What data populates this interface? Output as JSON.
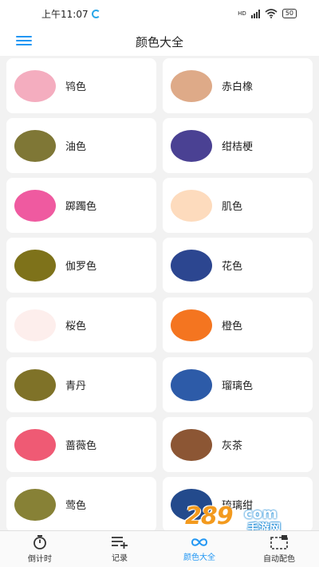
{
  "status_bar": {
    "time": "上午11:07",
    "network": "HD",
    "battery": "50"
  },
  "header": {
    "title": "颜色大全",
    "menu_icon": "hamburger-menu-icon"
  },
  "colors": [
    {
      "name": "鸨色",
      "hex": "#f4adbf"
    },
    {
      "name": "赤白橡",
      "hex": "#deaa88"
    },
    {
      "name": "油色",
      "hex": "#7f7736"
    },
    {
      "name": "绀桔梗",
      "hex": "#4a4193"
    },
    {
      "name": "踯躅色",
      "hex": "#ef5aa0"
    },
    {
      "name": "肌色",
      "hex": "#fddbbd"
    },
    {
      "name": "伽罗色",
      "hex": "#7e721a"
    },
    {
      "name": "花色",
      "hex": "#2c4690"
    },
    {
      "name": "桜色",
      "hex": "#fdeeec"
    },
    {
      "name": "橙色",
      "hex": "#f47520"
    },
    {
      "name": "青丹",
      "hex": "#7f7228"
    },
    {
      "name": "瑠璃色",
      "hex": "#2d5ba8"
    },
    {
      "name": "蔷薇色",
      "hex": "#ef5a74"
    },
    {
      "name": "灰茶",
      "hex": "#8c5634"
    },
    {
      "name": "莺色",
      "hex": "#878136"
    },
    {
      "name": "琉璃绀",
      "hex": "#234a8c"
    }
  ],
  "watermark": {
    "number": "289",
    "suffix": "com",
    "text": "手游网"
  },
  "tabs": [
    {
      "label": "倒计时",
      "icon": "stopwatch-icon",
      "active": false
    },
    {
      "label": "记录",
      "icon": "list-add-icon",
      "active": false
    },
    {
      "label": "颜色大全",
      "icon": "infinity-icon",
      "active": true
    },
    {
      "label": "自动配色",
      "icon": "palette-frame-icon",
      "active": false
    }
  ],
  "accent_color": "#2196f3"
}
